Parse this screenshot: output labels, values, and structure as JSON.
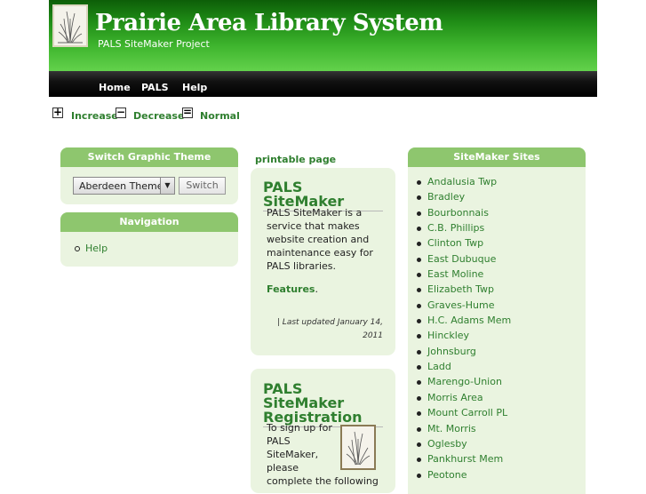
{
  "header": {
    "title": "Prairie Area Library System",
    "subtitle": "PALS SiteMaker Project",
    "logo_icon": "prairie-grass-icon"
  },
  "nav": {
    "items": [
      "Home",
      "PALS",
      "Help"
    ]
  },
  "text_size": {
    "increase_symbol": "+",
    "increase_label": "Increase",
    "decrease_symbol": "−",
    "decrease_label": "Decrease",
    "normal_symbol": "=",
    "normal_label": "Normal"
  },
  "theme_box": {
    "title": "Switch Graphic Theme",
    "selected_theme": "Aberdeen Theme",
    "switch_label": "Switch"
  },
  "navigation_box": {
    "title": "Navigation",
    "items": [
      "Help"
    ]
  },
  "printable_label": "printable page",
  "articles": [
    {
      "title": "PALS SiteMaker",
      "body": [
        "PALS SiteMaker is a",
        "service that makes",
        "website creation and",
        "maintenance easy for",
        "PALS libraries."
      ],
      "link": "Features",
      "link_suffix": ".",
      "updated": [
        "| Last updated January 14,",
        "2011"
      ]
    },
    {
      "title": [
        "PALS SiteMaker",
        "Registration"
      ],
      "body": [
        "To sign up for",
        "PALS",
        "SiteMaker,",
        "please",
        "complete the following"
      ]
    }
  ],
  "sites_box": {
    "title": "SiteMaker Sites",
    "items": [
      "Andalusia Twp",
      "Bradley",
      "Bourbonnais",
      "C.B. Phillips",
      "Clinton Twp",
      "East Dubuque",
      "East Moline",
      "Elizabeth Twp",
      "Graves-Hume",
      "H.C. Adams Mem",
      "Hinckley",
      "Johnsburg",
      "Ladd",
      "Marengo-Union",
      "Morris Area",
      "Mount Carroll PL",
      "Mt. Morris",
      "Oglesby",
      "Pankhurst Mem",
      "Peotone"
    ]
  },
  "colors": {
    "link_green": "#2f7f2f",
    "box_header_green": "#8ec66e",
    "box_body": "#eaf4e0"
  }
}
